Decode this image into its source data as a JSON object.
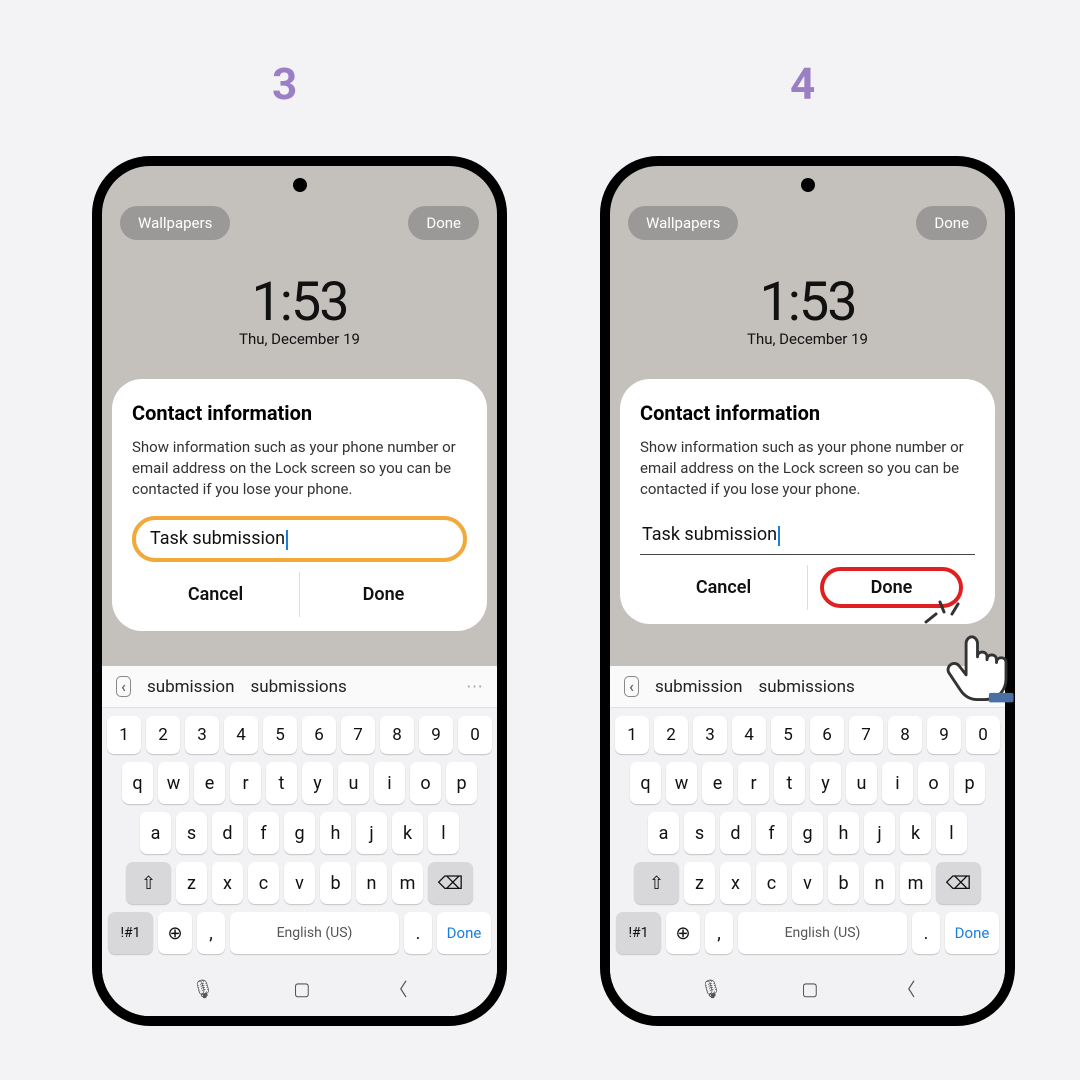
{
  "steps": {
    "s3": "3",
    "s4": "4"
  },
  "lock": {
    "wallpapers": "Wallpapers",
    "done": "Done",
    "time": "1:53",
    "date": "Thu, December 19"
  },
  "dialog": {
    "title": "Contact information",
    "body": "Show information such as your phone number or email address on the Lock screen so you can be contacted if you lose your phone.",
    "input": "Task submission",
    "cancel": "Cancel",
    "done": "Done"
  },
  "kb": {
    "sugg1": "submission",
    "sugg2": "submissions",
    "row_num": [
      "1",
      "2",
      "3",
      "4",
      "5",
      "6",
      "7",
      "8",
      "9",
      "0"
    ],
    "row1": [
      "q",
      "w",
      "e",
      "r",
      "t",
      "y",
      "u",
      "i",
      "o",
      "p"
    ],
    "row2": [
      "a",
      "s",
      "d",
      "f",
      "g",
      "h",
      "j",
      "k",
      "l"
    ],
    "row3": [
      "z",
      "x",
      "c",
      "v",
      "b",
      "n",
      "m"
    ],
    "shift": "⇧",
    "bksp": "⌫",
    "sym": "!#1",
    "globe": "🌐",
    "comma": ",",
    "space": "English (US)",
    "period": ".",
    "done": "Done",
    "mic": "🎤",
    "nav_sq": "▢",
    "nav_back": "〈"
  }
}
